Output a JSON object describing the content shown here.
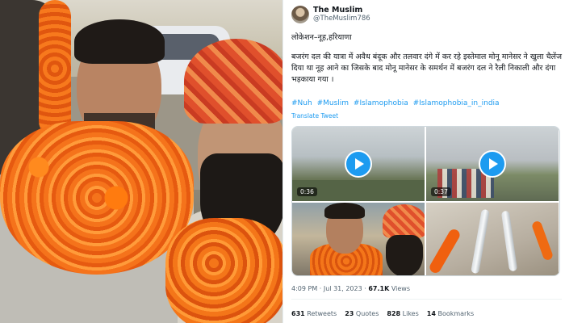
{
  "tweet": {
    "display_name": "The Muslim",
    "handle": "@TheMuslim786",
    "location_line": "लोकेशन–नूह,हरियाणा",
    "body_text": "बजरंग दल की यात्रा में अवैध बंदूक और तलवार दंगे में कर रहे इस्तेमाल मोनू मानेसर ने खुला चैलेंज दिया था नूह आने का जिसके बाद मोनू मानेसर के समर्थन में बजरंग दल ने रैली निकाली और दंगा भड़काया गया ।",
    "hashtags": [
      "#Nuh",
      "#Muslim",
      "#Islamophobia",
      "#Islamophobia_in_india"
    ],
    "translate_label": "Translate Tweet",
    "media": [
      {
        "type": "video",
        "duration": "0:36",
        "icon": "play-icon"
      },
      {
        "type": "video",
        "duration": "0:37",
        "icon": "play-icon"
      },
      {
        "type": "image"
      },
      {
        "type": "image"
      }
    ],
    "time": "4:09 PM",
    "date": "Jul 31, 2023",
    "views_count": "67.1K",
    "views_label": "Views",
    "retweets_count": "631",
    "retweets_label": "Retweets",
    "quotes_count": "23",
    "quotes_label": "Quotes",
    "likes_count": "828",
    "likes_label": "Likes",
    "bookmarks_count": "14",
    "bookmarks_label": "Bookmarks"
  },
  "colors": {
    "link": "#1d9bf0",
    "text": "#0f1419",
    "secondary": "#536471",
    "garland": "#f4761a"
  }
}
